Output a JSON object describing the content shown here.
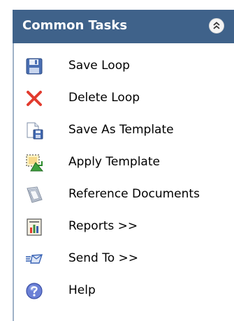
{
  "panel": {
    "title": "Common Tasks",
    "collapse_icon": "double-chevron-up-icon",
    "header_color": "#3f628a"
  },
  "tasks": [
    {
      "label": "Save Loop",
      "icon": "floppy-disk-icon"
    },
    {
      "label": "Delete Loop",
      "icon": "red-x-icon"
    },
    {
      "label": "Save As Template",
      "icon": "save-template-icon"
    },
    {
      "label": "Apply Template",
      "icon": "apply-template-icon"
    },
    {
      "label": "Reference Documents",
      "icon": "reference-documents-icon"
    },
    {
      "label": "Reports >>",
      "icon": "report-icon"
    },
    {
      "label": "Send To >>",
      "icon": "send-to-icon"
    },
    {
      "label": "Help",
      "icon": "help-icon"
    }
  ]
}
